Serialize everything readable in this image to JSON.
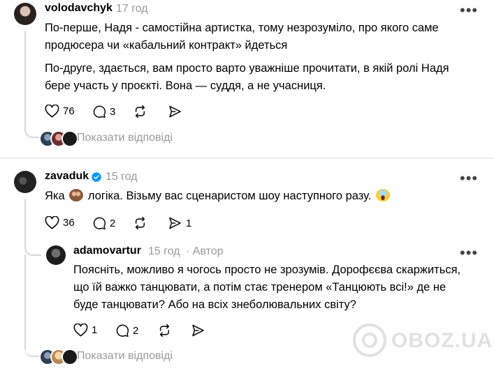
{
  "comments": [
    {
      "username": "volodavchyk",
      "time": "17 год",
      "paragraphs": [
        "По-перше, Надя - самостійна артистка, тому незрозуміло, про якого саме продюсера чи «кабальний контракт» йдеться",
        "По-друге, здається, вам просто варто уважніше прочитати, в якій ролі Надя бере участь у проєкті. Вона — суддя, а не учасниця."
      ],
      "likes": "76",
      "replies": "3",
      "show_replies": "Показати відповіді"
    },
    {
      "username": "zavaduk",
      "verified": true,
      "time": "15 год",
      "text_before": "Яка",
      "text_mid": "логіка. Візьму вас сценаристом шоу наступного разу.",
      "likes": "36",
      "replies": "2",
      "shares": "1"
    },
    {
      "username": "adamovartur",
      "time": "15 год",
      "author_label": "· Автор",
      "text": "Поясніть, можливо я чогось просто не зрозумів. Дорофєєва скаржиться, що їй важко танцювати, а потім стає тренером «Танцюють всі!» де не буде танцювати? Або на всіх знеболювальних світу?",
      "likes": "1",
      "replies": "2",
      "show_replies": "Показати відповіді"
    }
  ],
  "more_label": "•••",
  "watermark": "OBOZ.UA",
  "colors": {
    "muted": "#999999",
    "verified": "#0095f6",
    "line": "#d8d8d8"
  }
}
